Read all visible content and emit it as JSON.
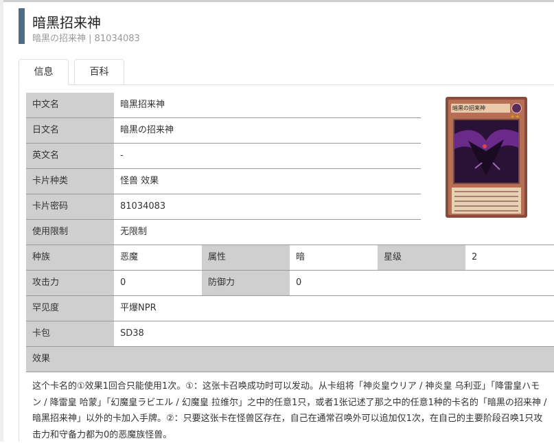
{
  "header": {
    "title": "暗黑招来神",
    "subtitle": "暗黒の招来神 | 81034083"
  },
  "tabs": [
    {
      "label": "信息",
      "active": true
    },
    {
      "label": "百科",
      "active": false
    }
  ],
  "fields": {
    "cn_name": {
      "label": "中文名",
      "value": "暗黑招来神"
    },
    "jp_name": {
      "label": "日文名",
      "value": "暗黒の招来神"
    },
    "en_name": {
      "label": "英文名",
      "value": "-"
    },
    "card_type": {
      "label": "卡片种类",
      "value": "怪兽 效果"
    },
    "password": {
      "label": "卡片密码",
      "value": "81034083"
    },
    "limit": {
      "label": "使用限制",
      "value": "无限制"
    },
    "race": {
      "label": "种族",
      "value": "恶魔"
    },
    "attribute": {
      "label": "属性",
      "value": "暗"
    },
    "level": {
      "label": "星级",
      "value": "2"
    },
    "atk": {
      "label": "攻击力",
      "value": "0"
    },
    "def": {
      "label": "防御力",
      "value": "0"
    },
    "rarity": {
      "label": "罕见度",
      "value": "平爆NPR"
    },
    "pack": {
      "label": "卡包",
      "value": "SD38"
    },
    "effect": {
      "label": "效果",
      "text": "这个卡名的①效果1回合只能使用1次。①：这张卡召唤成功时可以发动。从卡组将「神炎皇ウリア / 神炎皇 乌利亚」「降雷皇ハモン / 降雷皇 哈蒙」「幻魔皇ラビエル / 幻魔皇 拉维尔」之中的任意1只，或者1张记述了那之中的任意1种的卡名的「暗黒の招来神 / 暗黑招来神」以外的卡加入手牌。②：只要这张卡在怪兽区存在，自己在通常召唤外可以追加仅1次，在自己的主要阶段召唤1只攻击力和守备力都为0的恶魔族怪兽。"
    }
  },
  "card_image": {
    "name": "暗黒の招来神",
    "stars": "★★"
  }
}
